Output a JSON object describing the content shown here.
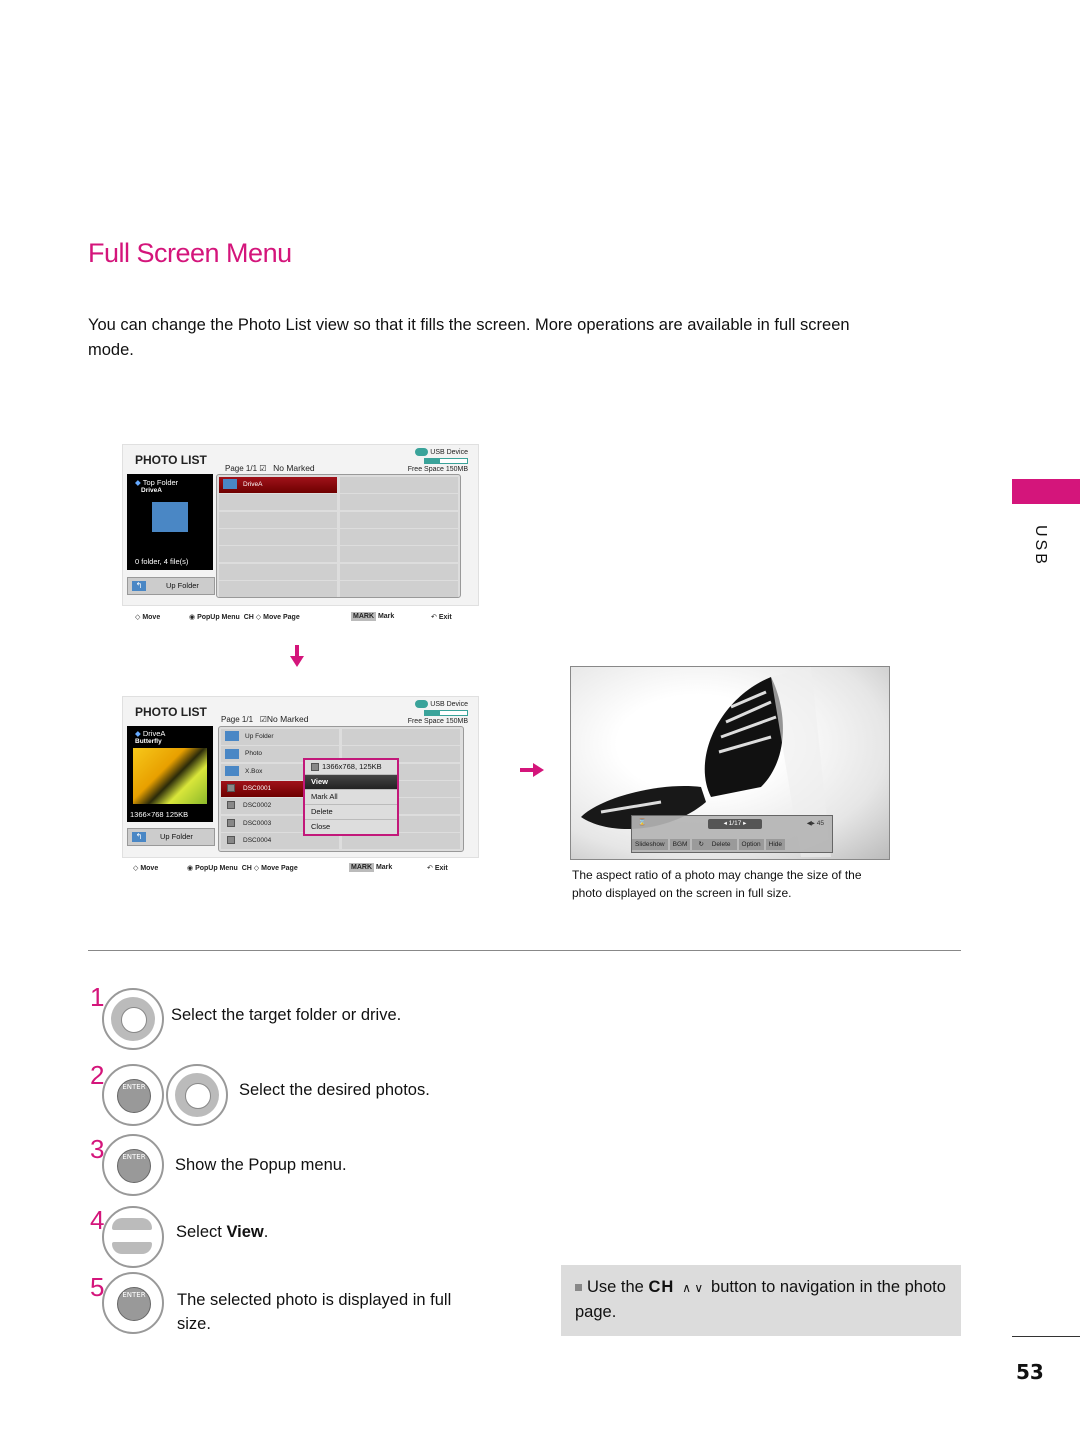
{
  "page": {
    "title": "Full Screen Menu",
    "intro": "You can change the Photo List view so that it fills the screen. More operations are available in full screen mode.",
    "section_tab": "USB",
    "page_number": "53",
    "accent_color": "#d4157b"
  },
  "screen1": {
    "title": "PHOTO LIST",
    "page": "Page 1/1",
    "marked": "No Marked",
    "usb_device": "USB Device",
    "free_space": "Free Space 150MB",
    "usb_fill_fraction": 0.35,
    "preview": {
      "heading": "Top Folder",
      "sub": "DriveA",
      "info": "0 folder, 4 file(s)"
    },
    "up_folder": "Up Folder",
    "items": [
      {
        "label": "DriveA",
        "type": "folder",
        "selected": true
      }
    ],
    "footer": {
      "move": "Move",
      "popup": "PopUp Menu",
      "ch": "CH",
      "move_page": "Move Page",
      "mark_key": "MARK",
      "mark": "Mark",
      "exit": "Exit"
    }
  },
  "screen2": {
    "title": "PHOTO LIST",
    "page": "Page 1/1",
    "marked": "No Marked",
    "usb_device": "USB Device",
    "free_space": "Free Space 150MB",
    "usb_fill_fraction": 0.35,
    "preview": {
      "heading": "DriveA",
      "sub": "Butterfly",
      "info": "1366×768  125KB"
    },
    "up_folder": "Up Folder",
    "items": [
      {
        "label": "Up Folder",
        "type": "up"
      },
      {
        "label": "Photo",
        "type": "folder"
      },
      {
        "label": "X.Box",
        "type": "folder"
      },
      {
        "label": "DSC0001",
        "type": "photo",
        "selected": true
      },
      {
        "label": "DSC0002",
        "type": "photo"
      },
      {
        "label": "DSC0003",
        "type": "photo"
      },
      {
        "label": "DSC0004",
        "type": "photo"
      }
    ],
    "popup": {
      "info": "1366x768, 125KB",
      "items": [
        "View",
        "Mark All",
        "Delete",
        "Close"
      ]
    },
    "footer": {
      "move": "Move",
      "popup": "PopUp Menu",
      "ch": "CH",
      "move_page": "Move Page",
      "mark_key": "MARK",
      "mark": "Mark",
      "exit": "Exit"
    }
  },
  "fullscreen": {
    "page": "1/17",
    "volume": "45",
    "buttons": [
      "Slideshow",
      "BGM",
      "Delete",
      "Option",
      "Hide"
    ],
    "caption": "The aspect ratio of a photo may change the size of the photo displayed on the screen in full size."
  },
  "steps": [
    {
      "num": "1",
      "text": "Select the target folder or drive."
    },
    {
      "num": "2",
      "text": "Select the desired photos."
    },
    {
      "num": "3",
      "text": "Show the Popup menu."
    },
    {
      "num": "4",
      "text_prefix": "Select ",
      "text_bold": "View",
      "text_suffix": "."
    },
    {
      "num": "5",
      "text": "The selected photo is displayed in full size."
    }
  ],
  "enter_label": "ENTER",
  "note": {
    "prefix": "Use the ",
    "bold": "CH",
    "suffix": " button to navigation in the photo page."
  }
}
